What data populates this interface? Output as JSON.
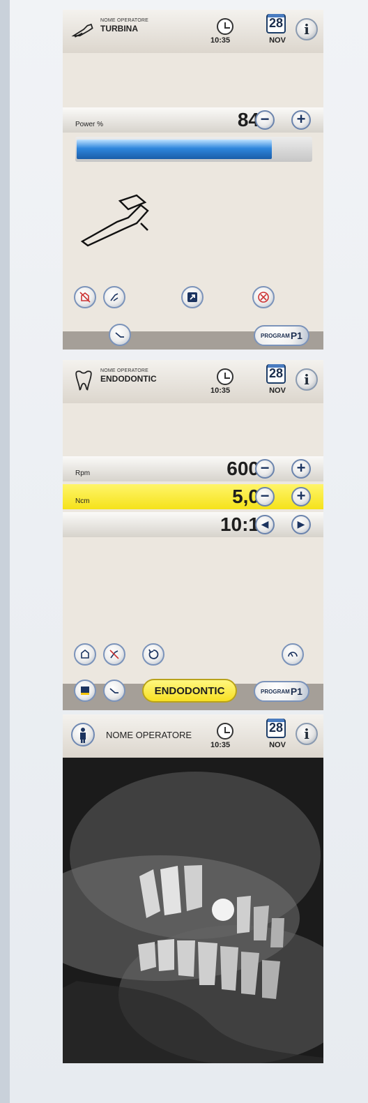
{
  "screens": {
    "turbina": {
      "operator_caption": "NOME OPERATORE",
      "mode": "TURBINA",
      "time": "10:35",
      "date_day": "28",
      "date_month": "NOV",
      "info_icon": "i",
      "power_label": "Power %",
      "power_value": "84",
      "power_level_percent": 84,
      "minus": "−",
      "plus": "+",
      "program_label": "PROGRAM",
      "program_number": "P1"
    },
    "endodontic": {
      "operator_caption": "NOME OPERATORE",
      "mode": "ENDODONTIC",
      "time": "10:35",
      "date_day": "28",
      "date_month": "NOV",
      "info_icon": "i",
      "rows": [
        {
          "label": "Rpm",
          "value": "600"
        },
        {
          "label": "Ncm",
          "value": "5,0"
        },
        {
          "label": "",
          "value": "10:1"
        }
      ],
      "minus": "−",
      "plus": "+",
      "left_arrow": "◀",
      "right_arrow": "▶",
      "endo_button": "ENDODONTIC",
      "program_label": "PROGRAM",
      "program_number": "P1"
    },
    "xray": {
      "operator_name": "NOME OPERATORE",
      "time": "10:35",
      "date_day": "28",
      "date_month": "NOV",
      "info_icon": "i"
    }
  },
  "colors": {
    "accent_blue": "#2f86dd",
    "highlight_yellow": "#f5e21a",
    "button_border": "#7b93ba"
  }
}
